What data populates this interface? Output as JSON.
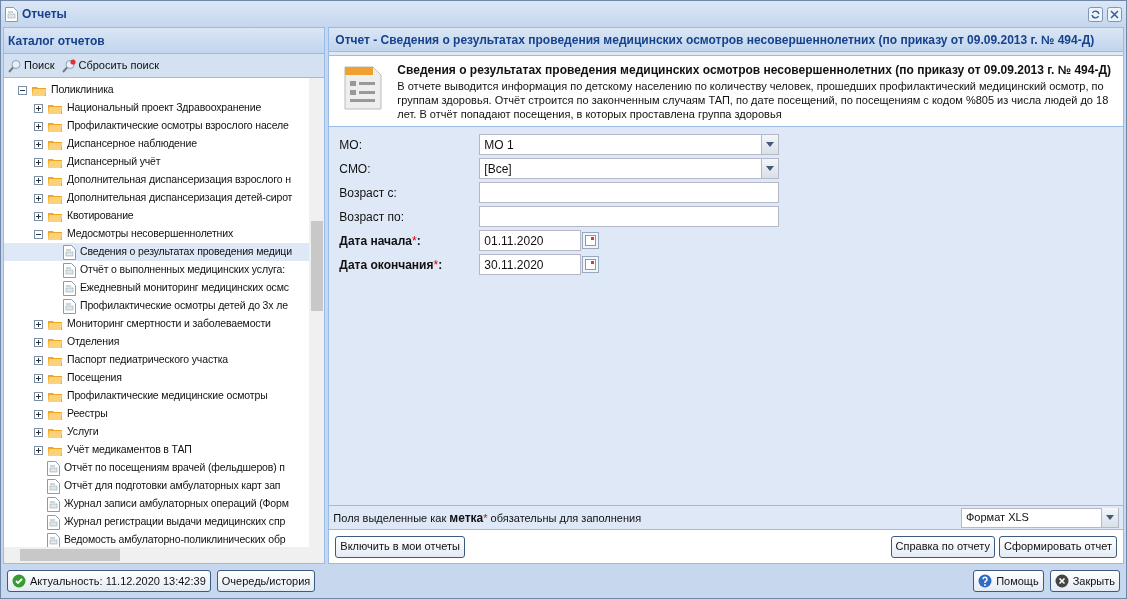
{
  "window": {
    "title": "Отчеты"
  },
  "catalog": {
    "title": "Каталог отчетов",
    "toolbar": [
      "Поиск",
      "Сбросить поиск"
    ],
    "tree": [
      {
        "kind": "folder",
        "label": "Поликлиника",
        "expanded": true,
        "selected": false,
        "children": [
          {
            "kind": "folder",
            "label": "Национальный проект Здравоохранение",
            "expanded": false,
            "selected": false
          },
          {
            "kind": "folder",
            "label": "Профилактические осмотры взрослого населе",
            "expanded": false,
            "selected": false
          },
          {
            "kind": "folder",
            "label": "Диспансерное наблюдение",
            "expanded": false,
            "selected": false
          },
          {
            "kind": "folder",
            "label": "Диспансерный учёт",
            "expanded": false,
            "selected": false
          },
          {
            "kind": "folder",
            "label": "Дополнительная диспансеризация взрослого н",
            "expanded": false,
            "selected": false
          },
          {
            "kind": "folder",
            "label": "Дополнительная диспансеризация детей-сирот",
            "expanded": false,
            "selected": false
          },
          {
            "kind": "folder",
            "label": "Квотирование",
            "expanded": false,
            "selected": false
          },
          {
            "kind": "folder",
            "label": "Медосмотры несовершеннолетних",
            "expanded": true,
            "selected": false,
            "children": [
              {
                "kind": "report",
                "label": "Сведения о результатах проведения медици",
                "selected": true
              },
              {
                "kind": "report",
                "label": "Отчёт о выполненных медицинских услуга:",
                "selected": false
              },
              {
                "kind": "report",
                "label": "Ежедневный мониторинг медицинских осмс",
                "selected": false
              },
              {
                "kind": "report",
                "label": "Профилактические осмотры детей до 3х ле",
                "selected": false
              }
            ]
          },
          {
            "kind": "folder",
            "label": "Мониторинг смертности и заболеваемости",
            "expanded": false,
            "selected": false
          },
          {
            "kind": "folder",
            "label": "Отделения",
            "expanded": false,
            "selected": false
          },
          {
            "kind": "folder",
            "label": "Паспорт педиатрического участка",
            "expanded": false,
            "selected": false
          },
          {
            "kind": "folder",
            "label": "Посещения",
            "expanded": false,
            "selected": false
          },
          {
            "kind": "folder",
            "label": "Профилактические медицинские осмотры",
            "expanded": false,
            "selected": false
          },
          {
            "kind": "folder",
            "label": "Реестры",
            "expanded": false,
            "selected": false
          },
          {
            "kind": "folder",
            "label": "Услуги",
            "expanded": false,
            "selected": false
          },
          {
            "kind": "folder",
            "label": "Учёт медикаментов в ТАП",
            "expanded": false,
            "selected": false
          },
          {
            "kind": "report",
            "label": "Отчёт по посещениям врачей (фельдшеров) п",
            "selected": false
          },
          {
            "kind": "report",
            "label": "Отчёт для подготовки амбулаторных карт зап",
            "selected": false
          },
          {
            "kind": "report",
            "label": "Журнал записи амбулаторных операций (Форм",
            "selected": false
          },
          {
            "kind": "report",
            "label": "Журнал регистрации выдачи медицинских спр",
            "selected": false
          },
          {
            "kind": "report",
            "label": "Ведомость амбулаторно-поликлинических обр",
            "selected": false
          }
        ]
      }
    ]
  },
  "report": {
    "header": "Отчет - Сведения о результатах проведения медицинских осмотров несовершеннолетних (по приказу от 09.09.2013 г. № 494-Д)",
    "title": "Сведения о результатах проведения медицинских осмотров несовершеннолетних (по приказу от 09.09.2013 г. № 494-Д)",
    "description": "В отчете выводится информация по детскому населению по количеству человек, прошедших профилактический медицинский осмотр, по группам здоровья. Отчёт строится по законченным случаям ТАП, по дате посещений, по посещениям с кодом %805 из числа людей до 18 лет. В отчёт попадают посещения, в которых проставлена группа здоровья",
    "required_mark": "*",
    "fields": [
      {
        "kind": "select",
        "label": "МО:",
        "value": "МО 1",
        "required": false
      },
      {
        "kind": "select",
        "label": "СМО:",
        "value": "[Все]",
        "required": false
      },
      {
        "kind": "text",
        "label": "Возраст с:",
        "required": false
      },
      {
        "kind": "text",
        "label": "Возраст по:",
        "required": false
      },
      {
        "kind": "date",
        "label": "Дата начала",
        "suffix": ":",
        "value": "01.11.2020",
        "required": true
      },
      {
        "kind": "date",
        "label": "Дата окончания",
        "suffix": ":",
        "value": "30.11.2020",
        "required": true
      }
    ],
    "note": {
      "before": "Поля выделенные как",
      "mark": "метка",
      "after": "обязательны для заполнения"
    },
    "format": "Формат XLS",
    "buttons_left": [
      "Включить в мои отчеты"
    ],
    "buttons_right": [
      "Справка по отчету",
      "Сформировать отчет"
    ]
  },
  "status_bar": {
    "actuality": "Актуальность: 11.12.2020 13:42:39",
    "queue": "Очередь/история",
    "help": "Помощь",
    "close": "Закрыть"
  }
}
